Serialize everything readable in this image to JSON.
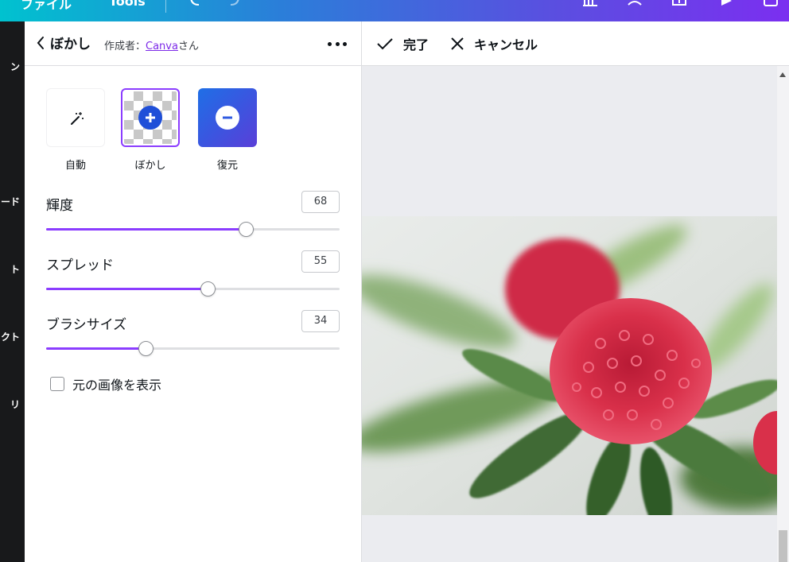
{
  "topbar": {
    "file_menu": "ファイル",
    "tools_menu": "Tools"
  },
  "rail": {
    "items": [
      "ン",
      "ード",
      "ト",
      "クト",
      "リ"
    ]
  },
  "panel": {
    "title": "ぼかし",
    "author_prefix": "作成者：",
    "author_link": "Canva",
    "author_suffix": "さん",
    "tools": [
      {
        "label": "自動",
        "icon": "magic-wand-icon"
      },
      {
        "label": "ぼかし",
        "icon": "plus-circle-icon",
        "selected": true
      },
      {
        "label": "復元",
        "icon": "minus-circle-icon"
      }
    ],
    "sliders": [
      {
        "label": "輝度",
        "value": "68",
        "fraction": 0.68
      },
      {
        "label": "スプレッド",
        "value": "55",
        "fraction": 0.55
      },
      {
        "label": "ブラシサイズ",
        "value": "34",
        "fraction": 0.34
      }
    ],
    "show_original_label": "元の画像を表示",
    "show_original_checked": false
  },
  "editor": {
    "done_label": "完了",
    "cancel_label": "キャンセル"
  },
  "colors": {
    "accent": "#8b3dff",
    "rail_bg": "#18191b",
    "canvas_bg": "#ebecf0",
    "flower": "#d9304a"
  }
}
